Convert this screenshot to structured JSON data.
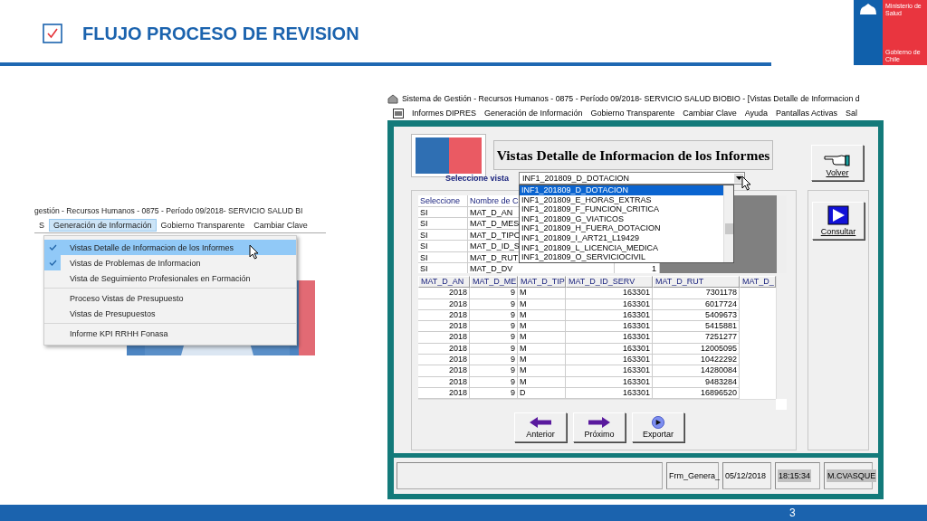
{
  "slide": {
    "title": "FLUJO PROCESO DE REVISION",
    "page_number": "3",
    "logo": {
      "ministry": "Ministerio de Salud",
      "government": "Gobierno de Chile"
    }
  },
  "menu_screenshot": {
    "title": "gestión - Recursos Humanos - 0875 - Período 09/2018- SERVICIO SALUD BI",
    "menu": [
      {
        "label": "S",
        "selected": false
      },
      {
        "label": "Generación de Información",
        "selected": true
      },
      {
        "label": "Gobierno Transparente",
        "selected": false
      },
      {
        "label": "Cambiar Clave",
        "selected": false
      }
    ],
    "dropdown_groups": [
      {
        "items": [
          {
            "label": "Vistas Detalle de Informacion de los Informes",
            "checked": true,
            "selected": true
          },
          {
            "label": "Vistas de Problemas de Informacion",
            "checked": true,
            "selected": false
          },
          {
            "label": "Vista de Seguimiento Profesionales en Formación",
            "checked": false,
            "selected": false
          }
        ]
      },
      {
        "items": [
          {
            "label": "Proceso Vistas de Presupuesto",
            "checked": false,
            "selected": false
          },
          {
            "label": "Vistas de Presupuestos",
            "checked": false,
            "selected": false
          }
        ]
      },
      {
        "items": [
          {
            "label": "Informe KPI RRHH Fonasa",
            "checked": false,
            "selected": false
          }
        ]
      }
    ]
  },
  "app_window": {
    "title": "Sistema de Gestión - Recursos Humanos - 0875 - Período 09/2018- SERVICIO SALUD BIOBIO - [Vistas Detalle de Informacion d",
    "menu": [
      "Informes DIPRES",
      "Generación de Información",
      "Gobierno Transparente",
      "Cambiar Clave",
      "Ayuda",
      "Pantallas Activas",
      "Sal"
    ],
    "form_title": "Vistas Detalle de Informacion de los Informes",
    "select_label": "Seleccione vista",
    "select_value": "INF1_201809_D_DOTACION",
    "options": [
      {
        "label": "INF1_201809_D_DOTACION",
        "selected": true
      },
      {
        "label": "INF1_201809_E_HORAS_EXTRAS",
        "selected": false
      },
      {
        "label": "INF1_201809_F_FUNCION_CRITICA",
        "selected": false
      },
      {
        "label": "INF1_201809_G_VIATICOS",
        "selected": false
      },
      {
        "label": "INF1_201809_H_FUERA_DOTACION",
        "selected": false
      },
      {
        "label": "INF1_201809_I_ART21_L19429",
        "selected": false
      },
      {
        "label": "INF1_201809_L_LICENCIA_MEDICA",
        "selected": false
      },
      {
        "label": "INF1_201809_O_SERVICIOCIVIL",
        "selected": false
      }
    ],
    "volver_button": "Volver",
    "consultar_button": "Consultar",
    "fields_table": {
      "columns": [
        "Seleccione",
        "Nombre de C"
      ],
      "rows": [
        [
          "SI",
          "MAT_D_AN"
        ],
        [
          "SI",
          "MAT_D_MES"
        ],
        [
          "SI",
          "MAT_D_TIPO"
        ],
        [
          "SI",
          "MAT_D_ID_S"
        ],
        [
          "SI",
          "MAT_D_RUT"
        ],
        [
          "SI",
          "MAT_D_DV",
          "1"
        ]
      ]
    },
    "data_grid": {
      "columns": [
        "MAT_D_AN",
        "MAT_D_ME",
        "MAT_D_TIP",
        "MAT_D_ID_SERV",
        "MAT_D_RUT",
        "MAT_D_"
      ],
      "rows": [
        [
          "2018",
          "9",
          "M",
          "163301",
          "7301178"
        ],
        [
          "2018",
          "9",
          "M",
          "163301",
          "6017724"
        ],
        [
          "2018",
          "9",
          "M",
          "163301",
          "5409673"
        ],
        [
          "2018",
          "9",
          "M",
          "163301",
          "5415881"
        ],
        [
          "2018",
          "9",
          "M",
          "163301",
          "7251277"
        ],
        [
          "2018",
          "9",
          "M",
          "163301",
          "12005095"
        ],
        [
          "2018",
          "9",
          "M",
          "163301",
          "10422292"
        ],
        [
          "2018",
          "9",
          "M",
          "163301",
          "14280084"
        ],
        [
          "2018",
          "9",
          "M",
          "163301",
          "9483284"
        ],
        [
          "2018",
          "9",
          "D",
          "163301",
          "16896520"
        ]
      ]
    },
    "nav_buttons": [
      {
        "kind": "previous",
        "label": "Anterior"
      },
      {
        "kind": "next",
        "label": "Próximo"
      },
      {
        "kind": "export",
        "label": "Exportar"
      }
    ],
    "status_bar": {
      "form": "Frm_Genera_",
      "date": "05/12/2018",
      "time": "18:15:34",
      "user": "M.CVASQUE"
    }
  }
}
